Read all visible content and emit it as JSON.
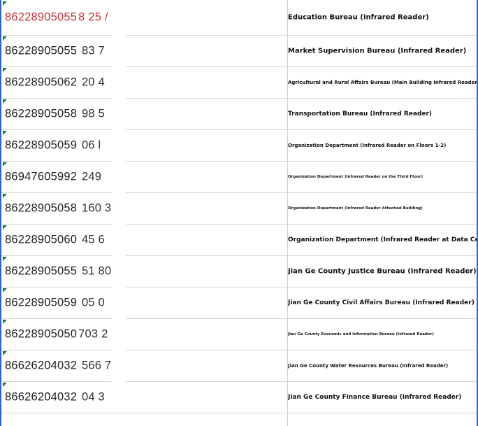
{
  "rows": [
    {
      "number": "86228905055",
      "tail": "8 25 /",
      "red": true,
      "label": "Education Bureau (Infrared Reader)"
    },
    {
      "number": "86228905055",
      "tail": "  83 7",
      "red": false,
      "label": "Market Supervision Bureau (Infrared Reader)"
    },
    {
      "number": "86228905062",
      "tail": "  20 4",
      "red": false,
      "label": "Agricultural and Rural Affairs Bureau (Main Building Infrared Reader)"
    },
    {
      "number": "86228905058",
      "tail": "  98 5",
      "red": false,
      "label": "Transportation Bureau (Infrared Reader)"
    },
    {
      "number": "86228905059",
      "tail": "  06 l",
      "red": false,
      "label": "Organization Department (Infrared Reader on Floors 1-2)"
    },
    {
      "number": "86947605992",
      "tail": " 249",
      "red": false,
      "label": "Organization Department (Infrared Reader on the Third Floor)"
    },
    {
      "number": "86228905058",
      "tail": " 160 3",
      "red": false,
      "label": "Organization Department (Infrared Reader Attached Building)"
    },
    {
      "number": "86228905060",
      "tail": " 45  6",
      "red": false,
      "label": "Organization Department (Infrared Reader at Data Center)"
    },
    {
      "number": "86228905055",
      "tail": " 51 80",
      "red": false,
      "label": "Jian Ge County Justice Bureau (Infrared Reader)"
    },
    {
      "number": "86228905059",
      "tail": " 05 0",
      "red": false,
      "label": "Jian Ge County Civil Affairs Bureau (Infrared Reader)"
    },
    {
      "number": "86228905050",
      "tail": "703 2",
      "red": false,
      "label": "Jian Ge County Economic and Information Bureau (Infrared Reader)"
    },
    {
      "number": "86626204032",
      "tail": " 566 7",
      "red": false,
      "label": "Jian Ge County Water Resources Bureau (Infrared Reader)"
    },
    {
      "number": "86626204032",
      "tail": " 04  3",
      "red": false,
      "label": "Jian Ge County Finance Bureau (Infrared Reader)"
    }
  ],
  "colors": {
    "accent_border": "#2f64c8",
    "marker": "#1f7a3a",
    "highlight_text": "#c4343a"
  }
}
